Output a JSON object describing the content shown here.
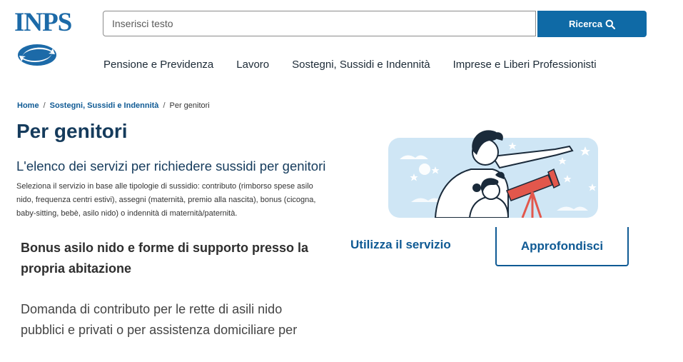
{
  "brand": {
    "logo_text": "INPS",
    "color": "#1c6aa8"
  },
  "search": {
    "placeholder": "Inserisci testo",
    "button_label": "Ricerca",
    "button_color": "#0f6aa6"
  },
  "nav": {
    "items": [
      {
        "label": "Pensione e Previdenza"
      },
      {
        "label": "Lavoro"
      },
      {
        "label": "Sostegni, Sussidi e Indennità"
      },
      {
        "label": "Imprese e Liberi Professionisti"
      }
    ]
  },
  "breadcrumb": {
    "home": "Home",
    "parent": "Sostegni, Sussidi e Indennità",
    "current": "Per genitori",
    "separator": "/"
  },
  "page": {
    "title": "Per genitori",
    "subtitle": "L'elenco dei servizi per richiedere sussidi per genitori",
    "description": "Seleziona il servizio in base alle tipologie di sussidio: contributo (rimborso spese asilo nido, frequenza centri estivi), assegni (maternità, premio alla nascita), bonus (cicogna, baby-sitting, bebè, asilo nido) o indennità di maternità/paternità."
  },
  "card": {
    "title": "Bonus asilo nido e forme di supporto presso la propria abitazione",
    "description": "Domanda di contributo per le rette di asili nido pubblici e privati o per assistenza domiciliare per",
    "use_label": "Utilizza il servizio",
    "more_label": "Approfondisci"
  },
  "colors": {
    "accent": "#0f5a94",
    "title": "#153b5c",
    "hero_sky": "#cfe6f5",
    "telescope": "#e2574c"
  },
  "icons": {
    "search": "search-icon",
    "logo": "inps-logo-icon"
  }
}
